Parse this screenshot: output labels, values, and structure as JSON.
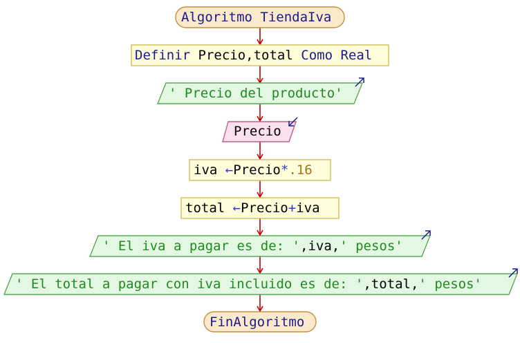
{
  "start": {
    "keyword": "Algoritmo",
    "name": "TiendaIva"
  },
  "define": {
    "keyword": "Definir",
    "vars": "Precio,total",
    "type_keyword": "Como Real"
  },
  "output1": {
    "text": "' Precio del producto'"
  },
  "input1": {
    "var": "Precio"
  },
  "assign1": {
    "target": "iva",
    "arrow": "←",
    "expr_var": "Precio",
    "operator": "*",
    "number": ".16"
  },
  "assign2": {
    "target": "total",
    "arrow": "←",
    "expr_var": "Precio",
    "operator": "+",
    "expr_var2": "iva"
  },
  "output2": {
    "str1": "' El iva a pagar es de: '",
    "comma1": ",",
    "var": "iva",
    "comma2": ",",
    "str2": "' pesos'"
  },
  "output3": {
    "str1": "' El total a pagar con iva incluido es de: '",
    "comma1": ",",
    "var": "total",
    "comma2": ",",
    "str2": "' pesos'"
  },
  "end": {
    "keyword": "FinAlgoritmo"
  },
  "colors": {
    "terminal_fill": "#fbe9cc",
    "terminal_stroke": "#c8903a",
    "process_fill": "#fefcd9",
    "process_stroke": "#cfbf5a",
    "output_fill": "#e3f7e3",
    "output_stroke": "#58a858",
    "input_fill": "#fbe0ee",
    "input_stroke": "#c45b8c",
    "arrow": "#c00000",
    "io_arrow": "#1a1a8c"
  }
}
